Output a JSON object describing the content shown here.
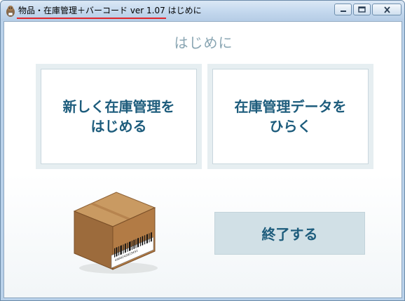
{
  "window": {
    "title": "物品・在庫管理＋バーコード ver 1.07 はじめに",
    "controls": [
      "minimize",
      "maximize",
      "close"
    ]
  },
  "main": {
    "heading": "はじめに",
    "buttons": {
      "new_inventory": "新しく在庫管理を\nはじめる",
      "open_data": "在庫管理データを\nひらく",
      "exit": "終了する"
    },
    "barcode_number": "4560243823451"
  },
  "colors": {
    "accent_text": "#1d5c7c",
    "heading_text": "#8aa6b3",
    "card_bg": "#e6eef1",
    "exit_bg": "#d1e0e6",
    "title_underline": "#e0262b"
  }
}
